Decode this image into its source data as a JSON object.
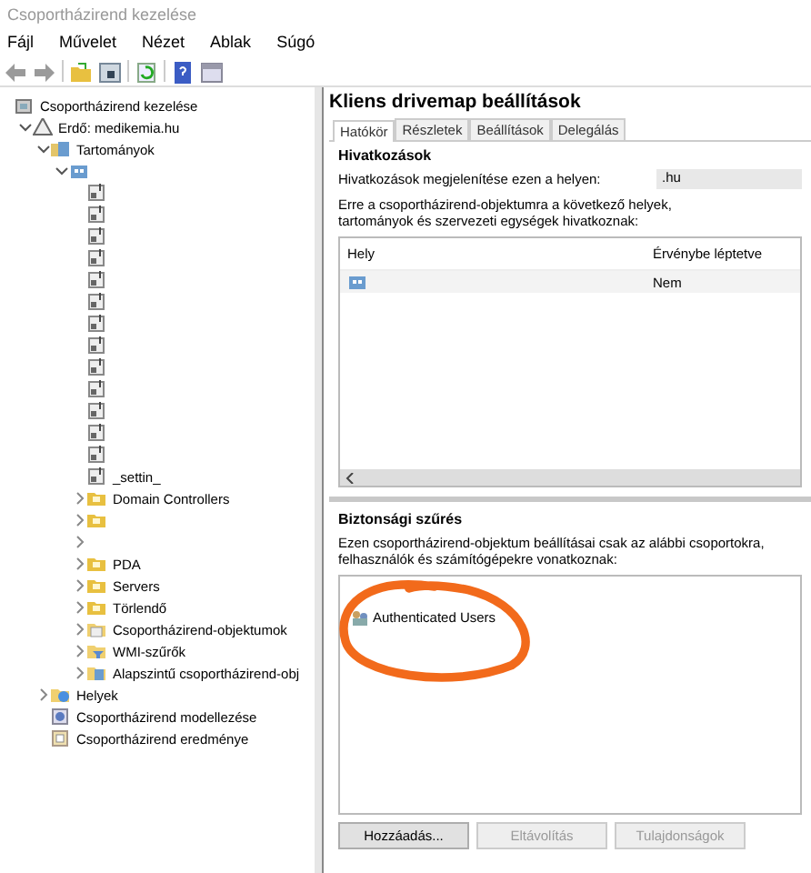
{
  "window": {
    "title": "Csoportházirend kezelése"
  },
  "menu": [
    "Fájl",
    "Művelet",
    "Nézet",
    "Ablak",
    "Súgó"
  ],
  "tree": [
    {
      "label": "Csoportházirend kezelése",
      "kind": "root",
      "children": [
        {
          "label": "Erdő: medikemia.hu",
          "kind": "forest",
          "expanded": true,
          "children": [
            {
              "label": "Tartományok",
              "kind": "domains",
              "expanded": true,
              "children": [
                {
                  "kind": "domain",
                  "expanded": true,
                  "children": [
                    {
                      "kind": "link"
                    },
                    {
                      "kind": "link"
                    },
                    {
                      "kind": "link"
                    },
                    {
                      "kind": "link"
                    },
                    {
                      "kind": "link"
                    },
                    {
                      "kind": "link"
                    },
                    {
                      "kind": "link"
                    },
                    {
                      "kind": "link"
                    },
                    {
                      "kind": "link"
                    },
                    {
                      "kind": "link"
                    },
                    {
                      "kind": "link"
                    },
                    {
                      "kind": "link"
                    },
                    {
                      "kind": "link"
                    },
                    {
                      "label": "_settin_",
                      "kind": "link"
                    },
                    {
                      "label": "Domain Controllers",
                      "kind": "ou",
                      "expanded": false
                    },
                    {
                      "kind": "ou",
                      "expanded": false
                    },
                    {
                      "kind": "none",
                      "expanded": false
                    },
                    {
                      "label": "PDA",
                      "kind": "ou",
                      "expanded": false
                    },
                    {
                      "label": "Servers",
                      "kind": "ou",
                      "expanded": false
                    },
                    {
                      "label": "Törlendő",
                      "kind": "ou",
                      "expanded": false
                    },
                    {
                      "label": "Csoportházirend-objektumok",
                      "kind": "gpos",
                      "expanded": false
                    },
                    {
                      "label": "WMI-szűrők",
                      "kind": "wmi",
                      "expanded": false
                    },
                    {
                      "label": "Alapszintű csoportházirend-obj",
                      "kind": "starter",
                      "expanded": false
                    }
                  ]
                }
              ]
            },
            {
              "label": "Helyek",
              "kind": "sites",
              "expanded": false
            },
            {
              "label": "Csoportházirend modellezése",
              "kind": "modeling"
            },
            {
              "label": "Csoportházirend eredménye",
              "kind": "results"
            }
          ]
        }
      ]
    }
  ],
  "details": {
    "title": "Kliens drivemap beállítások",
    "tabs": [
      {
        "label": "Hatókör",
        "selected": true
      },
      {
        "label": "Részletek",
        "selected": false
      },
      {
        "label": "Beállítások",
        "selected": false
      },
      {
        "label": "Delegálás",
        "selected": false
      }
    ],
    "links": {
      "heading": "Hivatkozások",
      "location_label": "Hivatkozások megjelenítése ezen a helyen:",
      "location_value": ".hu",
      "description": "Erre a csoportházirend-objektumra a következő helyek, tartományok és szervezeti egységek hivatkoznak:",
      "columns": [
        "Hely",
        "Érvénybe léptetve"
      ],
      "rows": [
        {
          "enforced": "Nem"
        }
      ]
    },
    "security": {
      "heading": "Biztonsági szűrés",
      "description": "Ezen csoportházirend-objektum beállításai csak az alábbi csoportokra, felhasználók és számítógépekre vonatkoznak:",
      "items": [
        "Authenticated Users"
      ],
      "buttons": [
        {
          "label": "Hozzáadás...",
          "disabled": false
        },
        {
          "label": "Eltávolítás",
          "disabled": true
        },
        {
          "label": "Tulajdonságok",
          "disabled": true
        }
      ]
    }
  }
}
